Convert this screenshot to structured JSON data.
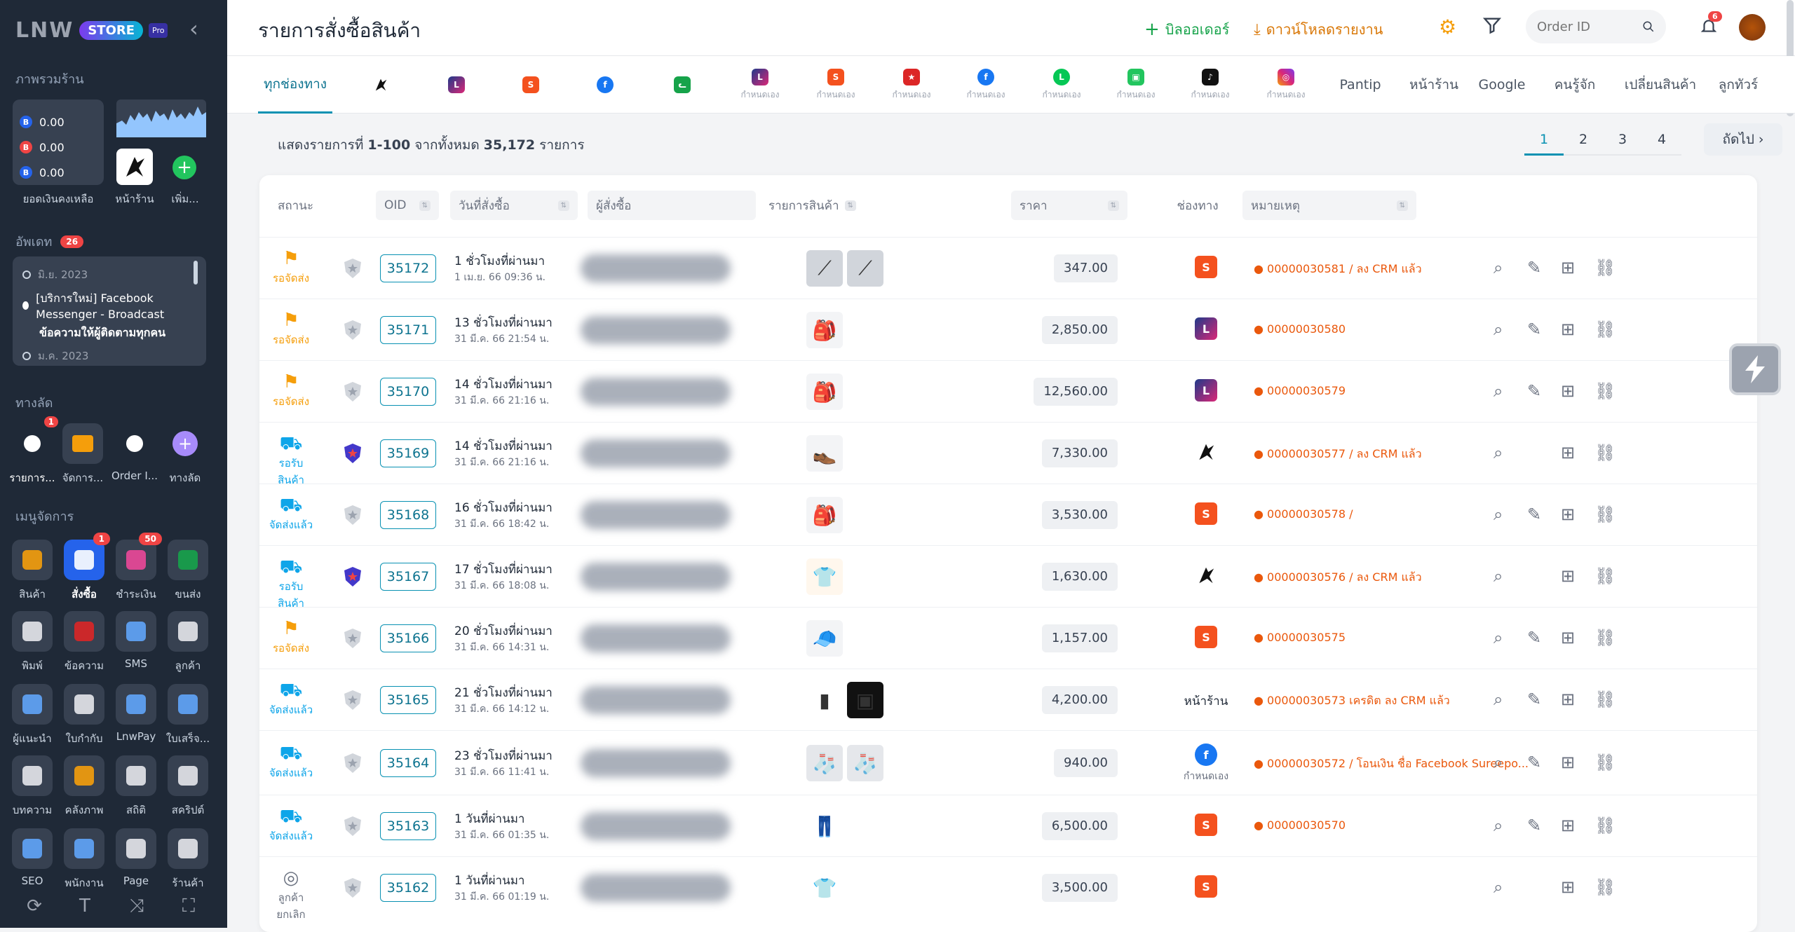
{
  "sidebar": {
    "logo_text": "LNW",
    "store_label": "STORE",
    "pro_label": "Pro",
    "overview_title": "ภาพรวมร้าน",
    "balances": [
      {
        "icon": "B",
        "color": "#2563eb",
        "value": "0.00"
      },
      {
        "icon": "B",
        "color": "#ef4444",
        "value": "0.00"
      },
      {
        "icon": "B",
        "color": "#2563eb",
        "value": "0.00"
      }
    ],
    "balance_label": "ยอดเงินคงเหลือ",
    "shop_label": "หน้าร้าน",
    "add_label": "เพิ่ม...",
    "update_title": "อัพเดท",
    "update_count": "26",
    "news": [
      {
        "date": "มิ.ย. 2023"
      },
      {
        "text1": "[บริการใหม่] Facebook Messenger - Broadcast",
        "text2": "ข้อความให้ผู้ติดตามทุกคน"
      },
      {
        "date": "ม.ค. 2023"
      }
    ],
    "shortcut_title": "ทางลัด",
    "shortcuts": [
      {
        "label": "รายการ...",
        "badge": "1"
      },
      {
        "label": "จัดการ..."
      },
      {
        "label": "Order I..."
      },
      {
        "label": "ทางลัด"
      }
    ],
    "menu_title": "เมนูจัดการ",
    "menu": [
      {
        "label": "สินค้า"
      },
      {
        "label": "สั่งซื้อ",
        "badge": "1"
      },
      {
        "label": "ชำระเงิน",
        "badge": "50"
      },
      {
        "label": "ขนส่ง"
      },
      {
        "label": "พิมพ์"
      },
      {
        "label": "ข้อความ"
      },
      {
        "label": "SMS"
      },
      {
        "label": "ลูกค้า"
      },
      {
        "label": "ผู้แนะนำ"
      },
      {
        "label": "ใบกำกับ"
      },
      {
        "label": "LnwPay"
      },
      {
        "label": "ใบเสร็จ..."
      },
      {
        "label": "บทความ"
      },
      {
        "label": "คลังภาพ"
      },
      {
        "label": "สถิติ"
      },
      {
        "label": "สคริปต์"
      },
      {
        "label": "SEO"
      },
      {
        "label": "พนักงาน"
      },
      {
        "label": "Page"
      },
      {
        "label": "ร้านค้า"
      }
    ]
  },
  "header": {
    "title": "รายการสั่งซื้อสินค้า",
    "add_order": "บิลออเดอร์",
    "download": "ดาวน์โหลดรายงาน",
    "search_placeholder": "Order ID",
    "notif_count": "6"
  },
  "tabs": [
    {
      "label": "ทุกช่องทาง"
    },
    {
      "icon": "lnw"
    },
    {
      "icon": "lazada"
    },
    {
      "icon": "shopee"
    },
    {
      "icon": "facebook"
    },
    {
      "icon": "cat"
    },
    {
      "icon": "lazada",
      "sub": "กำหนดเอง"
    },
    {
      "icon": "shopee",
      "sub": "กำหนดเอง"
    },
    {
      "icon": "other",
      "sub": "กำหนดเอง"
    },
    {
      "icon": "facebook",
      "sub": "กำหนดเอง"
    },
    {
      "icon": "line",
      "sub": "กำหนดเอง"
    },
    {
      "icon": "bag",
      "sub": "กำหนดเอง"
    },
    {
      "icon": "tiktok",
      "sub": "กำหนดเอง"
    },
    {
      "icon": "instagram",
      "sub": "กำหนดเอง"
    },
    {
      "label": "Pantip"
    },
    {
      "label": "หน้าร้าน"
    },
    {
      "label": "Google"
    },
    {
      "label": "คนรู้จัก"
    },
    {
      "label": "เปลี่ยนสินค้า"
    },
    {
      "label": "ลูกทัวร์"
    }
  ],
  "summary": {
    "prefix": "แสดงรายการที่",
    "range": "1-100",
    "mid": "จากทั้งหมด",
    "total": "35,172",
    "suffix": "รายการ"
  },
  "pager": {
    "pages": [
      "1",
      "2",
      "3",
      "4"
    ],
    "next": "ถัดไป ›"
  },
  "columns": {
    "status": "สถานะ",
    "oid": "OID",
    "date": "วันที่สั่งซื้อ",
    "buyer": "ผู้สั่งซื้อ",
    "items": "รายการสินค้า",
    "price": "ราคา",
    "channel": "ช่องทาง",
    "note": "หมายเหตุ"
  },
  "orders": [
    {
      "status": "รอจัดส่ง",
      "stype": "wait",
      "oid": "35172",
      "ago": "1 ชั่วโมงที่ผ่านมา",
      "date": "1 เม.ย. 66 09:36 น.",
      "thumbs": [
        "rod",
        "rod"
      ],
      "price": "347.00",
      "channel": "shopee",
      "note": "● 00000030581 / ลง CRM แล้ว",
      "acts": 4
    },
    {
      "status": "รอจัดส่ง",
      "stype": "wait",
      "oid": "35171",
      "ago": "13 ชั่วโมงที่ผ่านมา",
      "date": "31 มี.ค. 66 21:54 น.",
      "thumbs": [
        "bag"
      ],
      "price": "2,850.00",
      "channel": "lazada",
      "note": "● 00000030580",
      "acts": 4
    },
    {
      "status": "รอจัดส่ง",
      "stype": "wait",
      "oid": "35170",
      "ago": "14 ชั่วโมงที่ผ่านมา",
      "date": "31 มี.ค. 66 21:16 น.",
      "thumbs": [
        "bag"
      ],
      "price": "12,560.00",
      "channel": "lazada",
      "note": "● 00000030579",
      "acts": 4
    },
    {
      "status": "รอรับสินค้า",
      "stype": "recv",
      "oid": "35169",
      "ago": "14 ชั่วโมงที่ผ่านมา",
      "date": "31 มี.ค. 66 21:16 น.",
      "thumbs": [
        "shoe"
      ],
      "price": "7,330.00",
      "channel": "lnw",
      "note": "● 00000030577 / ลง CRM แล้ว",
      "acts": 3
    },
    {
      "status": "จัดส่งแล้ว",
      "stype": "sent",
      "oid": "35168",
      "ago": "16 ชั่วโมงที่ผ่านมา",
      "date": "31 มี.ค. 66 18:42 น.",
      "thumbs": [
        "bag"
      ],
      "price": "3,530.00",
      "channel": "shopee",
      "note": "● 00000030578 /",
      "acts": 4
    },
    {
      "status": "รอรับสินค้า",
      "stype": "recv",
      "oid": "35167",
      "ago": "17 ชั่วโมงที่ผ่านมา",
      "date": "31 มี.ค. 66 18:08 น.",
      "thumbs": [
        "shirt"
      ],
      "price": "1,630.00",
      "channel": "lnw",
      "note": "● 00000030576 / ลง CRM แล้ว",
      "acts": 3
    },
    {
      "status": "รอจัดส่ง",
      "stype": "wait",
      "oid": "35166",
      "ago": "20 ชั่วโมงที่ผ่านมา",
      "date": "31 มี.ค. 66 14:31 น.",
      "thumbs": [
        "cap"
      ],
      "price": "1,157.00",
      "channel": "shopee",
      "note": "● 00000030575",
      "acts": 4
    },
    {
      "status": "จัดส่งแล้ว",
      "stype": "sent",
      "oid": "35165",
      "ago": "21 ชั่วโมงที่ผ่านมา",
      "date": "31 มี.ค. 66 14:12 น.",
      "thumbs": [
        "mat",
        "box"
      ],
      "price": "4,200.00",
      "channel": "หน้าร้าน",
      "note": "● 00000030573 เครดิต ลง CRM แล้ว",
      "acts": 4
    },
    {
      "status": "จัดส่งแล้ว",
      "stype": "sent",
      "oid": "35164",
      "ago": "23 ชั่วโมงที่ผ่านมา",
      "date": "31 มี.ค. 66 11:41 น.",
      "thumbs": [
        "sock",
        "sock"
      ],
      "price": "940.00",
      "channel": "facebook",
      "channel_sub": "กำหนดเอง",
      "note": "● 00000030572 / โอนเงิน ชื่อ Facebook Sureepo...",
      "acts": 4
    },
    {
      "status": "จัดส่งแล้ว",
      "stype": "sent",
      "oid": "35163",
      "ago": "1 วันที่ผ่านมา",
      "date": "31 มี.ค. 66 01:35 น.",
      "thumbs": [
        "pants"
      ],
      "price": "6,500.00",
      "channel": "shopee",
      "note": "● 00000030570",
      "acts": 4
    },
    {
      "status": "ลูกค้ายกเลิก",
      "stype": "cancel",
      "oid": "35162",
      "ago": "1 วันที่ผ่านมา",
      "date": "31 มี.ค. 66 01:19 น.",
      "thumbs": [
        "shirt2"
      ],
      "price": "3,500.00",
      "channel": "shopee",
      "note": "",
      "acts": 3
    }
  ]
}
